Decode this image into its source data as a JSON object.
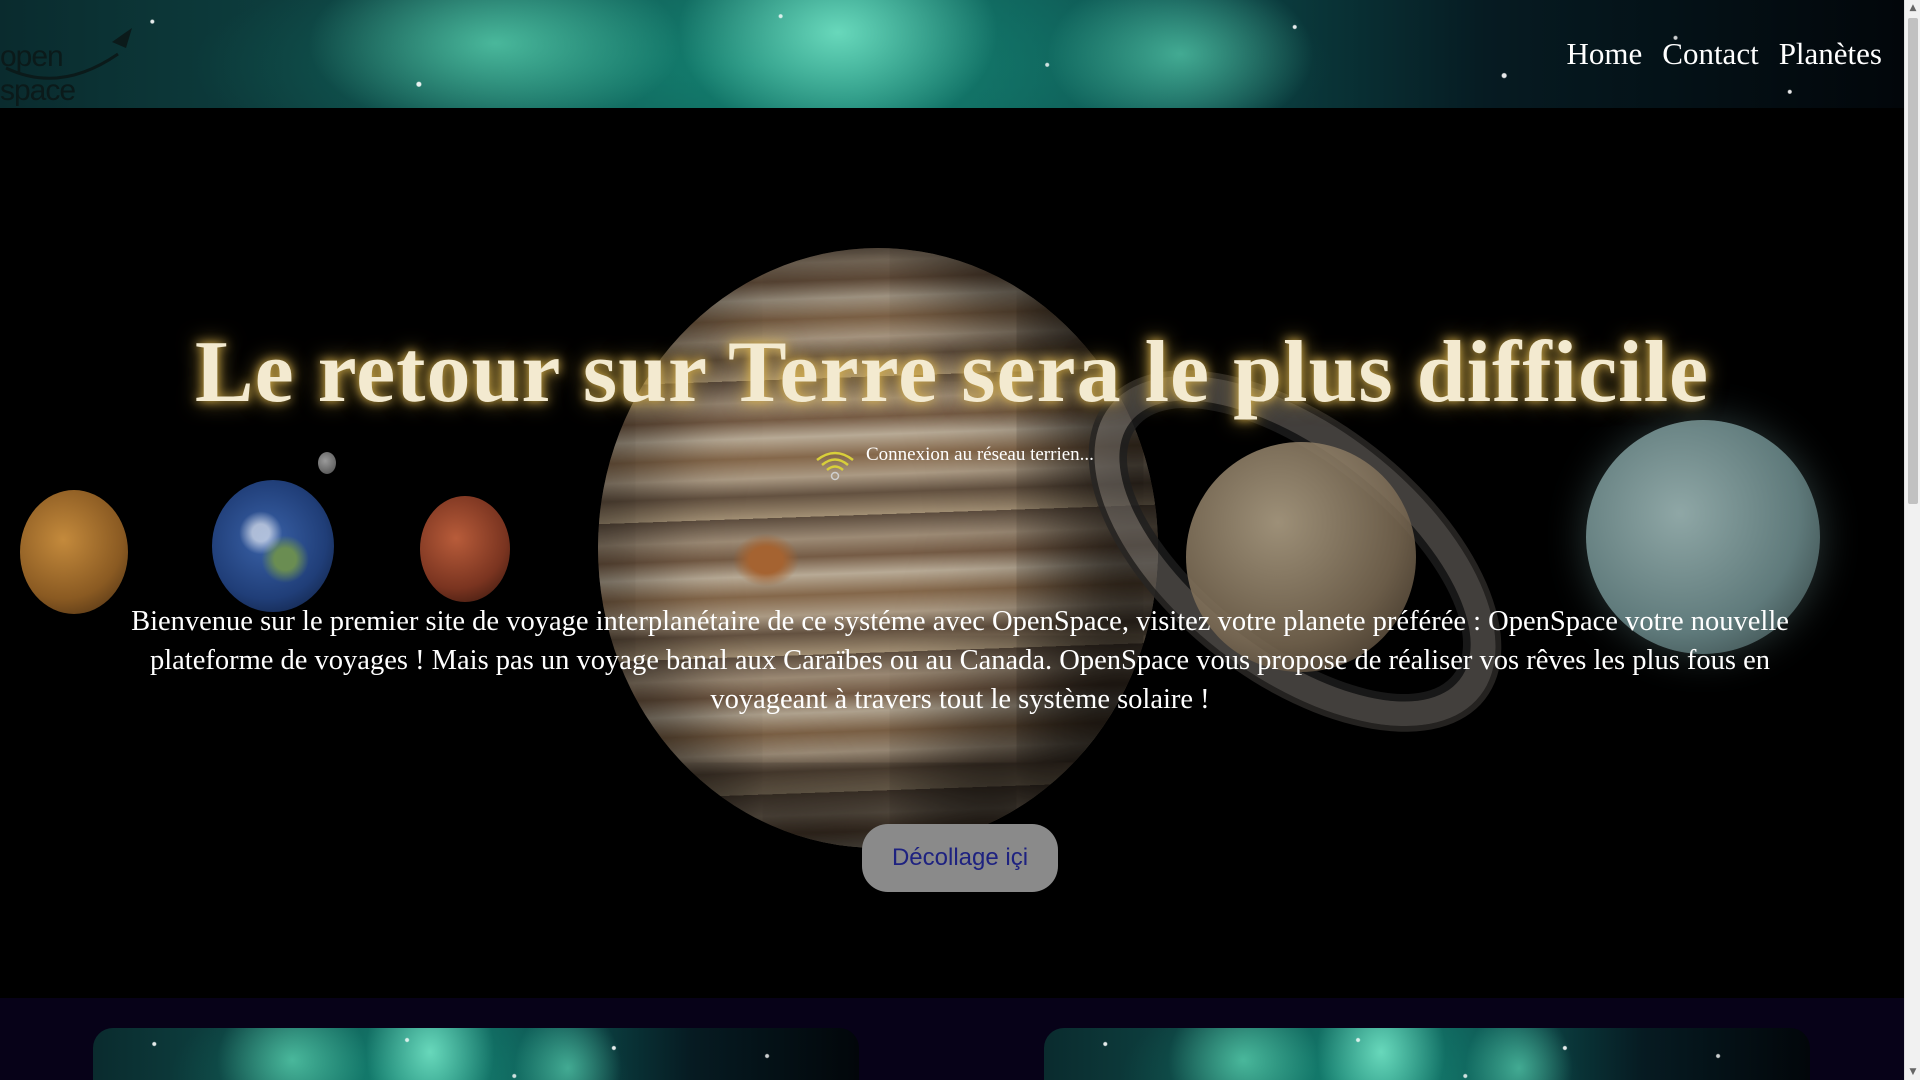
{
  "header": {
    "logo_text": "open space",
    "nav": [
      {
        "label": "Home"
      },
      {
        "label": "Contact"
      },
      {
        "label": "Planètes"
      }
    ]
  },
  "hero": {
    "title": "Le retour sur Terre sera le plus difficile",
    "status_text": "Connexion au réseau terrien...",
    "intro": "Bienvenue sur le premier site de voyage interplanétaire de ce systéme avec OpenSpace, visitez votre planete préférée : OpenSpace votre nouvelle plateforme de voyages ! Mais pas un voyage banal aux Caraïbes ou au Canada. OpenSpace vous propose de réaliser vos rêves les plus fous en voyageant à travers tout le système solaire !",
    "cta_label": "Décollage içi"
  },
  "colors": {
    "title_glow": "#d9b24c",
    "cta_background": "#8a8a8a",
    "cta_text": "#1e2280",
    "wifi_icon": "#d8cf3a",
    "cards_section_bg": "#070218"
  },
  "icons": {
    "logo": "rocket-logo-icon",
    "status": "wifi-icon"
  }
}
